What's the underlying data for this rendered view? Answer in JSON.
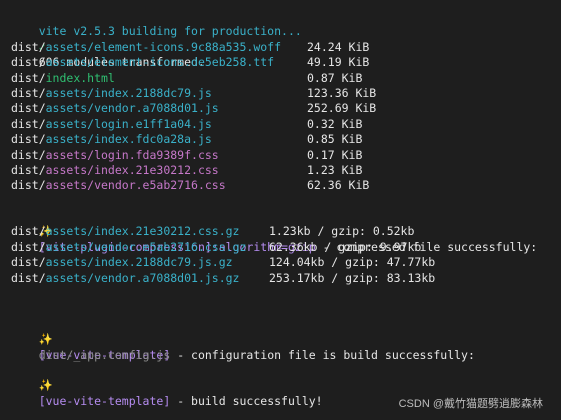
{
  "header": {
    "title": "vite v2.5.3 building for production...",
    "check": "✓",
    "transformed": "606 modules transformed."
  },
  "files": [
    {
      "prefix": "dist/",
      "path": "assets/element-icons.9c88a535.woff",
      "size": "24.24 KiB",
      "color": "#3ab1c9"
    },
    {
      "prefix": "dist/",
      "path": "assets/element-icons.de5eb258.ttf",
      "size": "49.19 KiB",
      "color": "#3ab1c9"
    },
    {
      "prefix": "dist/",
      "path": "index.html",
      "size": "0.87 KiB",
      "color": "#2fbf71"
    },
    {
      "prefix": "dist/",
      "path": "assets/index.2188dc79.js",
      "size": "123.36 KiB",
      "color": "#3ab1c9"
    },
    {
      "prefix": "dist/",
      "path": "assets/vendor.a7088d01.js",
      "size": "252.69 KiB",
      "color": "#3ab1c9"
    },
    {
      "prefix": "dist/",
      "path": "assets/login.e1ff1a04.js",
      "size": "0.32 KiB",
      "color": "#3ab1c9"
    },
    {
      "prefix": "dist/",
      "path": "assets/index.fdc0a28a.js",
      "size": "0.85 KiB",
      "color": "#3ab1c9"
    },
    {
      "prefix": "dist/",
      "path": "assets/login.fda9389f.css",
      "size": "0.17 KiB",
      "color": "#c678c9"
    },
    {
      "prefix": "dist/",
      "path": "assets/index.21e30212.css",
      "size": "1.23 KiB",
      "color": "#c678c9"
    },
    {
      "prefix": "dist/",
      "path": "assets/vendor.e5ab2716.css",
      "size": "62.36 KiB",
      "color": "#c678c9"
    }
  ],
  "compression": {
    "sparkle": "✨",
    "plugin": "[vite-plugin-compression]:algorithm=gzip",
    "message": " - compressed file successfully:",
    "rows": [
      {
        "prefix": "dist/",
        "path": "assets/index.21e30212.css.gz",
        "stats": "1.23kb / gzip: 0.52kb"
      },
      {
        "prefix": "dist/",
        "path": "assets/vendor.e5ab2716.css.gz",
        "stats": "62.36kb / gzip: 9.97kb"
      },
      {
        "prefix": "dist/",
        "path": "assets/index.2188dc79.js.gz",
        "stats": "124.04kb / gzip: 47.77kb"
      },
      {
        "prefix": "dist/",
        "path": "assets/vendor.a7088d01.js.gz",
        "stats": "253.17kb / gzip: 83.13kb"
      }
    ]
  },
  "config": {
    "sparkle": "✨",
    "plugin": "[vue-vite-template]",
    "message": " - configuration file is build successfully:",
    "file": "dist/_app.config.js"
  },
  "build": {
    "sparkle": "✨",
    "plugin": "[vue-vite-template]",
    "message": " - build successfully!"
  },
  "watermark": {
    "text": "CSDN @戴竹猫题劈逍膨森林"
  }
}
